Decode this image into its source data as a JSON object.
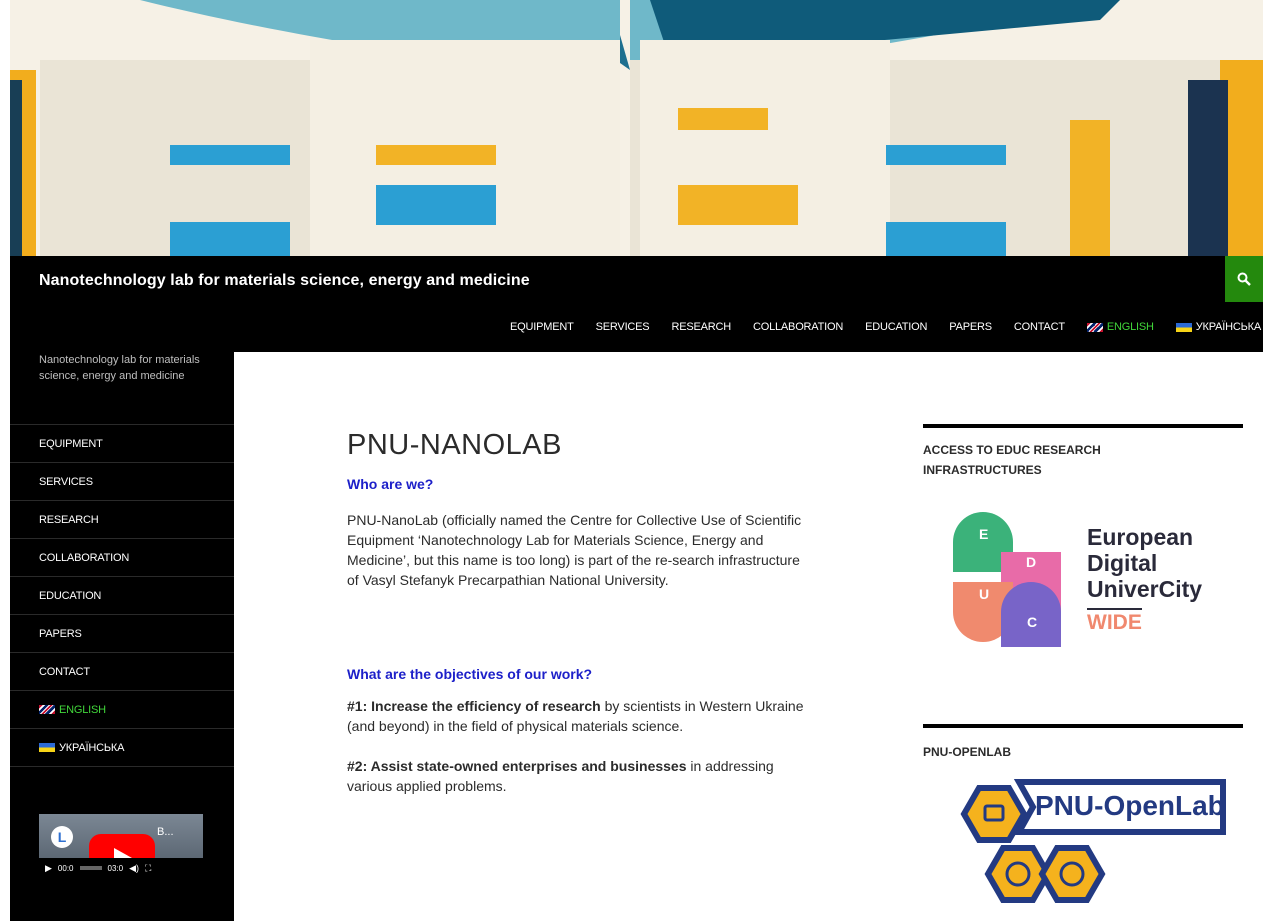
{
  "header": {
    "site_title": "Nanotechnology lab for materials science, energy and medicine"
  },
  "top_nav": [
    {
      "label": "EQUIPMENT"
    },
    {
      "label": "SERVICES"
    },
    {
      "label": "RESEARCH"
    },
    {
      "label": "COLLABORATION"
    },
    {
      "label": "EDUCATION"
    },
    {
      "label": "PAPERS"
    },
    {
      "label": "CONTACT"
    },
    {
      "label": "ENGLISH",
      "flag": "uk-flag-icon",
      "active": true
    },
    {
      "label": "УКРАЇНСЬКА",
      "flag": "ua-flag-icon"
    }
  ],
  "sidebar": {
    "description": "Nanotechnology lab for materials science, energy and medicine",
    "items": [
      {
        "label": "EQUIPMENT"
      },
      {
        "label": "SERVICES"
      },
      {
        "label": "RESEARCH"
      },
      {
        "label": "COLLABORATION"
      },
      {
        "label": "EDUCATION"
      },
      {
        "label": "PAPERS"
      },
      {
        "label": "CONTACT"
      },
      {
        "label": "ENGLISH",
        "flag": "uk-flag-icon",
        "active": true
      },
      {
        "label": "УКРАЇНСЬКА",
        "flag": "ua-flag-icon"
      }
    ],
    "video": {
      "title": "B...",
      "current_time": "00:0",
      "duration": "03:0"
    }
  },
  "main": {
    "title": "PNU-NANOLAB",
    "heading1": "Who are we?",
    "para1": "PNU-NanoLab (officially named the Centre for Collective Use of Scientific Equipment ‘Nanotechnology Lab for Materials Science, Energy and Medicine’, but this name is too long) is part of the re-search infrastructure of Vasyl Stefanyk Precarpathian National University.",
    "heading2": "What are the objectives of our work?",
    "objective1_bold": "#1: Increase the efficiency of research",
    "objective1_rest": " by scientists in Western Ukraine (and beyond) in the field of physical materials science.",
    "objective2_bold": "#2: Assist state-owned enterprises and businesses",
    "objective2_rest": " in addressing various applied problems."
  },
  "widgets": [
    {
      "title": "ACCESS TO EDUC RESEARCH INFRASTRUCTURES",
      "logo": {
        "letters": [
          "E",
          "D",
          "U",
          "C"
        ],
        "lines": [
          "European",
          "Digital",
          "UniverCity",
          "WIDE"
        ]
      }
    },
    {
      "title": "PNU-OPENLAB",
      "logo": {
        "text": "PNU-OpenLab"
      }
    }
  ],
  "colors": {
    "accent_green": "#24890d",
    "active_nav": "#41d63a",
    "heading_blue": "#1d20c9"
  }
}
